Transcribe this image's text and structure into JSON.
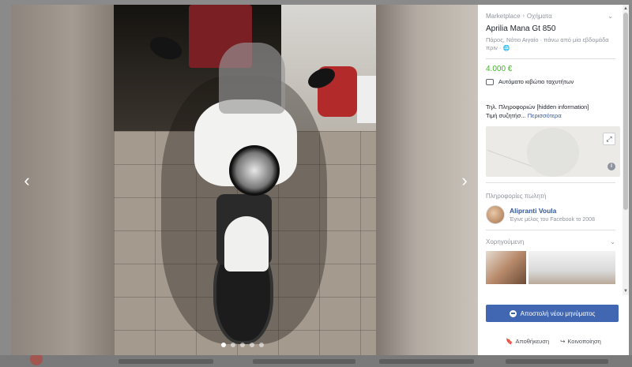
{
  "viewer": {
    "prev_arrow": "‹",
    "next_arrow": "›",
    "photo_count": 5,
    "active_photo": 1
  },
  "panel": {
    "breadcrumb": [
      "Marketplace",
      "Οχήματα"
    ],
    "breadcrumb_sep": "›",
    "title": "Aprilia Mana Gt 850",
    "subline": "Πάρος, Νότιο Αιγαίο · πάνω από μία εβδομάδα πριν ·",
    "price": "4.000 €",
    "transmission": "Αυτόματο κιβώτιο ταχυτήτων",
    "desc_line1": "Τηλ. Πληροφοριών [hidden information]",
    "desc_line2": "Τιμή συζητήσ...",
    "desc_more": "Περισσότερα",
    "seller_header": "Πληροφορίες πωλητή",
    "seller_name": "Alipranti Voula",
    "seller_sub": "Έγινε μέλος του Facebook το 2008",
    "sponsored": "Χορηγούμενη"
  },
  "actions": {
    "send_message": "Αποστολή νέου μηνύματος",
    "save": "Αποθήκευση",
    "share": "Κοινοποίηση"
  },
  "colors": {
    "price": "#42b72a",
    "primary_button": "#4267b2",
    "link": "#365899"
  }
}
